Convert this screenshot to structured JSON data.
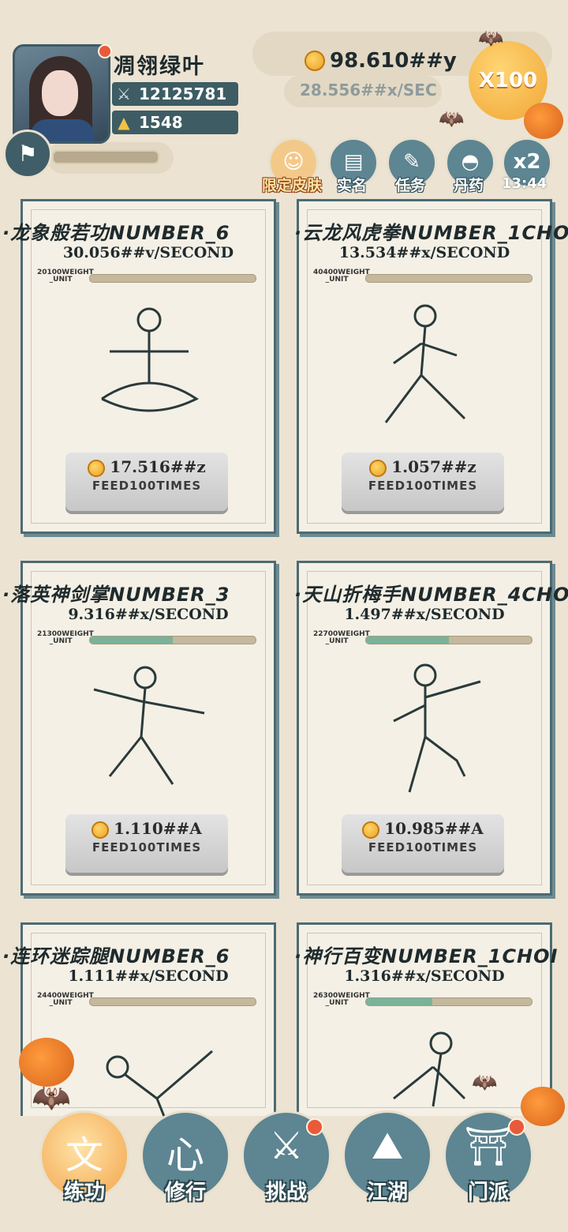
{
  "player": {
    "name": "凋翎绿叶",
    "power": "12125781",
    "ingots": "1548"
  },
  "currency": {
    "gold": "98.610##y",
    "rate": "28.556##x/SEC",
    "multiplier": "X100"
  },
  "menu": {
    "skin": "限定皮肤",
    "realname": "实名",
    "task": "任务",
    "pill": "丹药",
    "speed": "x2",
    "timer": "13:44"
  },
  "cards": [
    {
      "title": "·龙象般若功NUMBER_6",
      "rate": "30.056##v/SECOND",
      "weight": "20100WEIGHT",
      "unit": "_UNIT",
      "fill": 0.0,
      "cost": "17.516##z",
      "feed": "FEED100TIMES"
    },
    {
      "title": "·云龙风虎拳NUMBER_1CHO",
      "rate": "13.534##x/SECOND",
      "weight": "40400WEIGHT",
      "unit": "_UNIT",
      "fill": 0.0,
      "cost": "1.057##z",
      "feed": "FEED100TIMES"
    },
    {
      "title": "·落英神剑掌NUMBER_3",
      "rate": "9.316##x/SECOND",
      "weight": "21300WEIGHT",
      "unit": "_UNIT",
      "fill": 0.5,
      "cost": "1.110##A",
      "feed": "FEED100TIMES"
    },
    {
      "title": "·天山折梅手NUMBER_4CHO",
      "rate": "1.497##x/SECOND",
      "weight": "22700WEIGHT",
      "unit": "_UNIT",
      "fill": 0.5,
      "cost": "10.985##A",
      "feed": "FEED100TIMES"
    },
    {
      "title": "·连环迷踪腿NUMBER_6",
      "rate": "1.111##x/SECOND",
      "weight": "24400WEIGHT",
      "unit": "_UNIT",
      "fill": 0.0,
      "cost": "",
      "feed": ""
    },
    {
      "title": "·神行百变NUMBER_1CHOI",
      "rate": "1.316##x/SECOND",
      "weight": "26300WEIGHT",
      "unit": "_UNIT",
      "fill": 0.4,
      "cost": "",
      "feed": ""
    }
  ],
  "nav": {
    "practice": "练功",
    "cultivate": "修行",
    "challenge": "挑战",
    "jianghu": "江湖",
    "sect": "门派"
  }
}
